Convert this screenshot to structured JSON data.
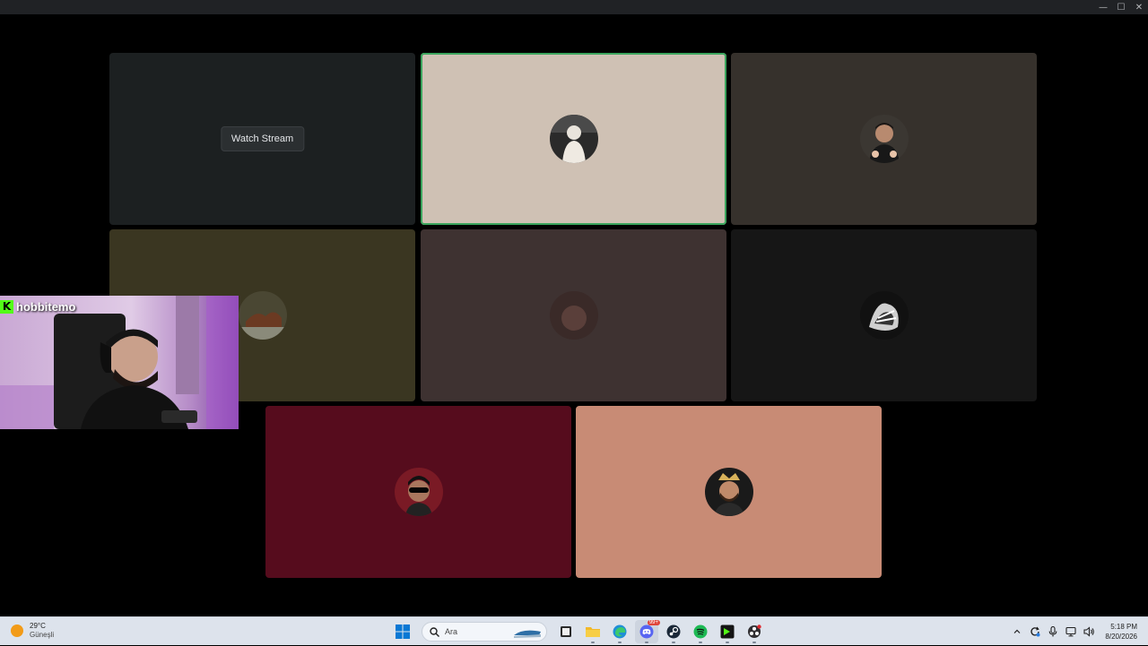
{
  "window": {
    "minimize_glyph": "—",
    "maximize_glyph": "☐",
    "close_glyph": "✕"
  },
  "call": {
    "tiles": [
      {
        "kind": "stream",
        "background": "#1c2021",
        "watch_label": "Watch Stream"
      },
      {
        "kind": "user",
        "background": "#cfc1b4",
        "speaking": true,
        "avatar_icon": "user-avatar-icon"
      },
      {
        "kind": "user",
        "background": "#36312c",
        "avatar_icon": "user-avatar-icon"
      },
      {
        "kind": "user",
        "background": "#3a3621",
        "avatar_icon": "user-avatar-icon"
      },
      {
        "kind": "user",
        "background": "#3e3231",
        "avatar_icon": "user-avatar-icon"
      },
      {
        "kind": "user",
        "background": "#161616",
        "avatar_icon": "user-avatar-icon"
      },
      {
        "kind": "user",
        "background": "#560c1d",
        "avatar_icon": "user-avatar-icon"
      },
      {
        "kind": "user",
        "background": "#c88b75",
        "avatar_icon": "user-avatar-icon"
      }
    ],
    "speaking_color": "#3ba55d"
  },
  "webcam": {
    "platform_icon": "kick-logo-icon",
    "platform_glyph": "K",
    "platform_color": "#53fc18",
    "username": "hobbitemo"
  },
  "taskbar": {
    "weather": {
      "temp": "29°C",
      "desc": "Güneşli",
      "icon": "sun-icon"
    },
    "search_placeholder": "Ara",
    "pinned": [
      "windows-start-icon",
      "search-icon",
      "task-view-icon",
      "file-explorer-icon",
      "edge-browser-icon",
      "discord-icon",
      "steam-icon",
      "spotify-icon",
      "terminal-app-icon",
      "obs-icon"
    ],
    "discord_badge": "99+",
    "clock": {
      "time": "5:18 PM",
      "date": "8/20/2026"
    },
    "tray": [
      "chevron-up-icon",
      "sync-icon",
      "microphone-icon",
      "network-icon",
      "volume-icon"
    ]
  }
}
